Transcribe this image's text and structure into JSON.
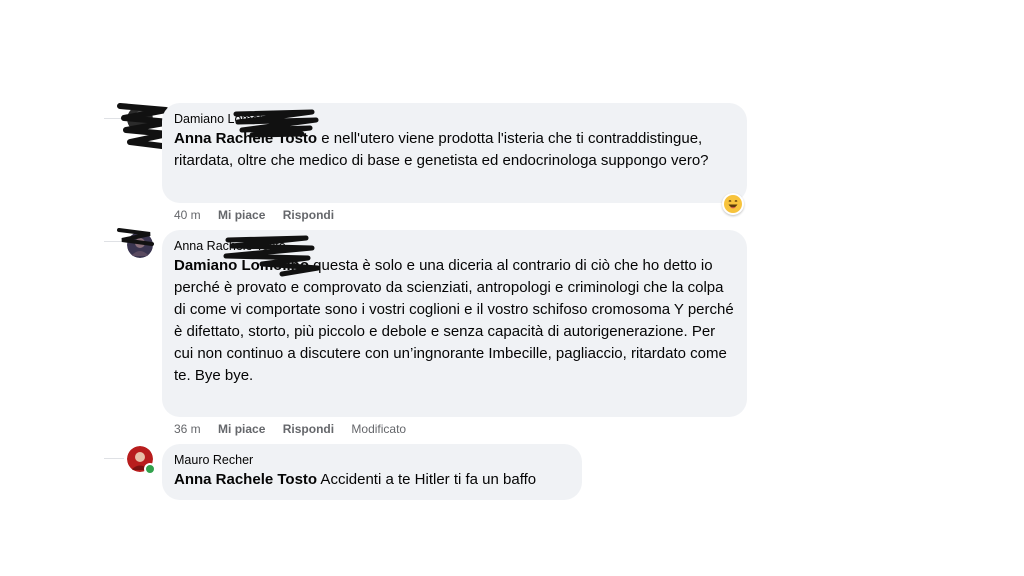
{
  "comments": [
    {
      "author": "Damiano Lomolino",
      "mention": "Anna Rachele Tosto",
      "text": " e nell'utero viene prodotta l'isteria che ti contraddistingue, ritardata, oltre che medico di base e genetista ed endocrinologa suppongo vero?",
      "time": "40 m",
      "like_label": "Mi piace",
      "reply_label": "Rispondi",
      "reaction_icon": "laughing-emoji-icon"
    },
    {
      "author": "Anna Rachele Tosto",
      "mention": "Damiano Lomolino",
      "text": " questa è solo e una diceria al contrario di ciò che ho detto io perché è provato e comprovato da scienziati, antropologi e criminologi che la colpa di come vi comportate sono i vostri coglioni e il vostro schifoso cromosoma Y perché è difettato, storto, più piccolo e debole e senza capacità di autorigenerazione. Per cui non continuo a discutere con un’ingnorante Imbecille, pagliaccio, ritardato come te. Bye bye.",
      "time": "36 m",
      "like_label": "Mi piace",
      "reply_label": "Rispondi",
      "edited_label": "Modificato"
    },
    {
      "author": "Mauro Recher",
      "mention": "Anna Rachele Tosto",
      "text": " Accidenti a te Hitler ti fa un baffo",
      "online": true
    }
  ],
  "colors": {
    "bubble": "#f0f2f5",
    "meta": "#65676b",
    "online": "#31a24c"
  }
}
